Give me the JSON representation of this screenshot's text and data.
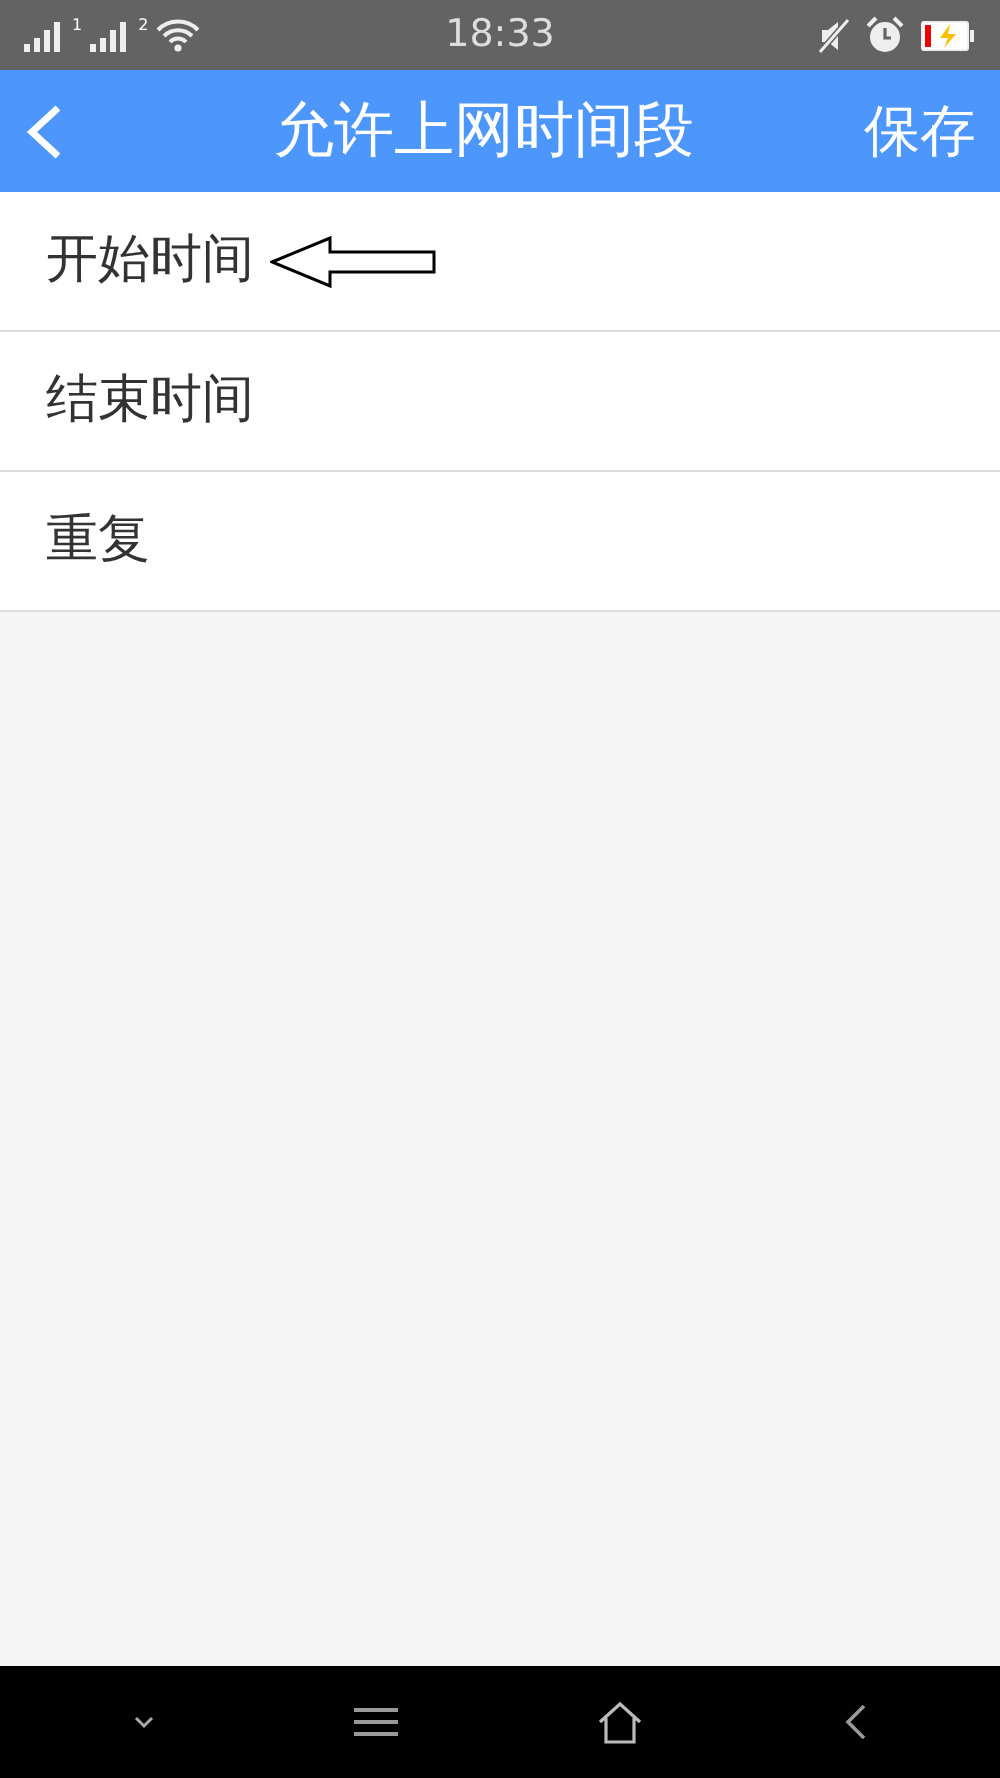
{
  "status_bar": {
    "sim_slots": [
      "1",
      "2"
    ],
    "time": "18:33"
  },
  "header": {
    "title": "允许上网时间段",
    "action": "保存"
  },
  "items": [
    {
      "label": "开始时间",
      "annotated": true
    },
    {
      "label": "结束时间",
      "annotated": false
    },
    {
      "label": "重复",
      "annotated": false
    }
  ]
}
